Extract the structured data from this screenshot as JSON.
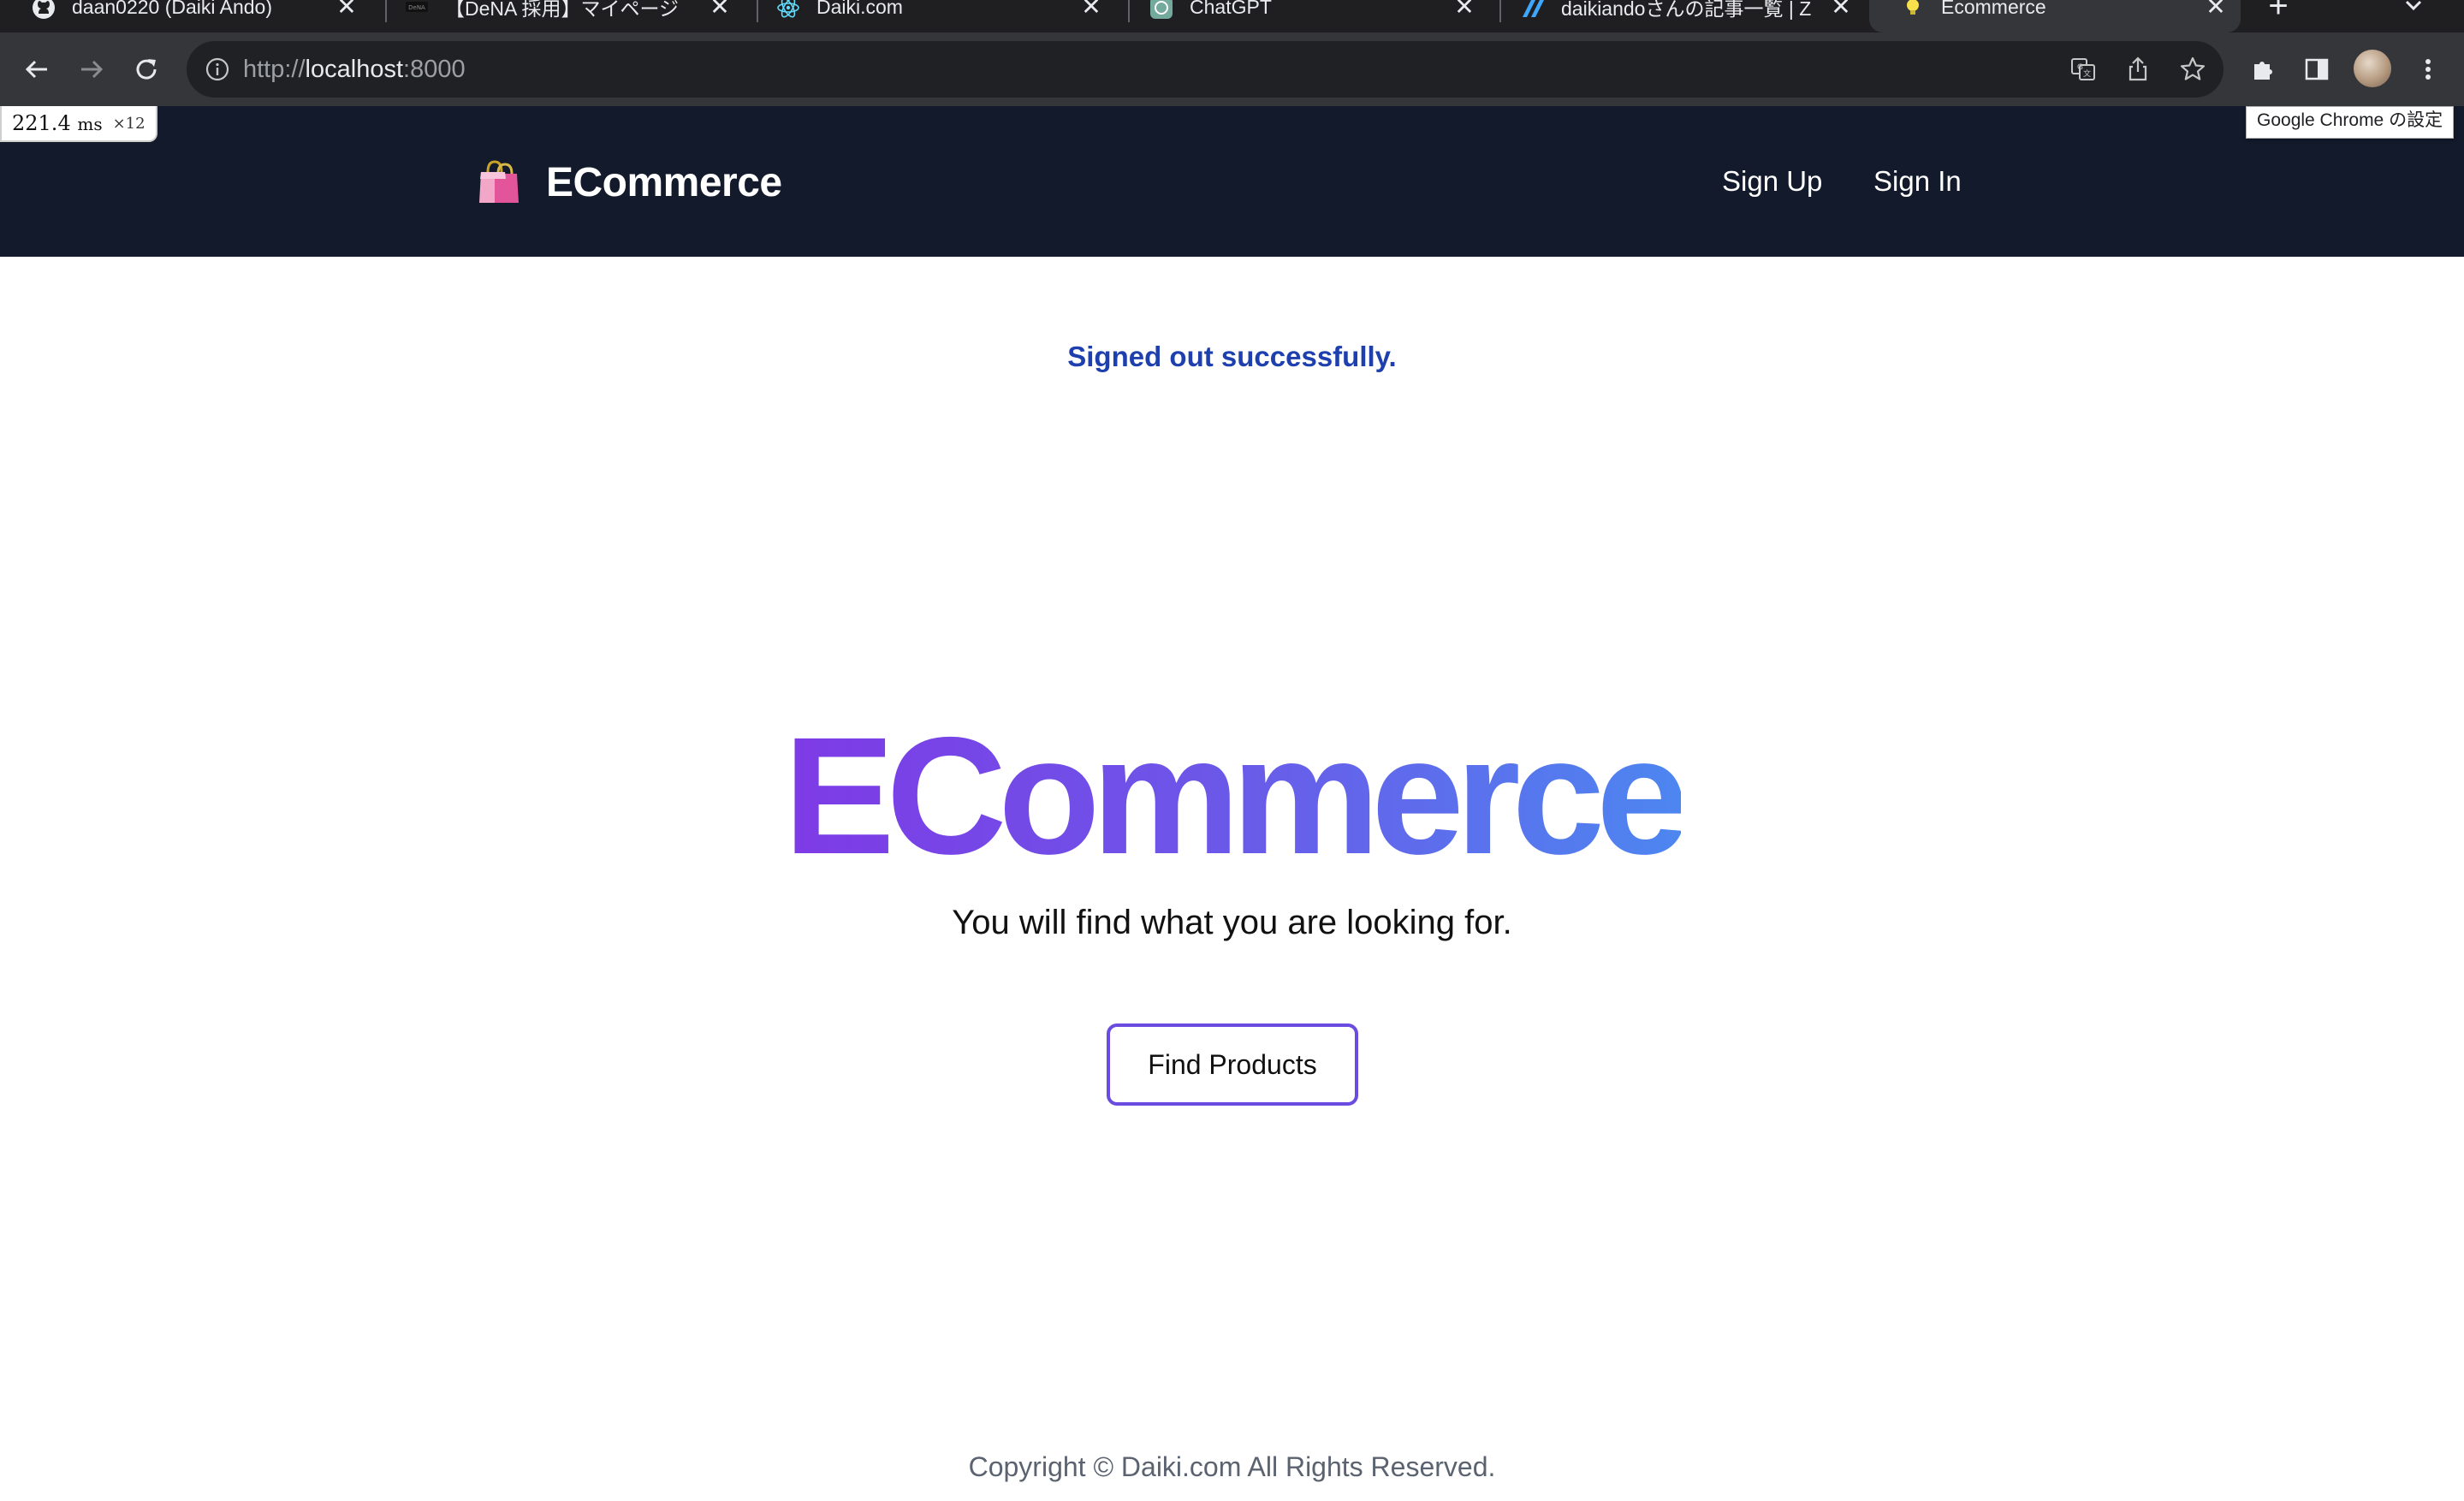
{
  "browser": {
    "tabs": [
      {
        "title": "daan0220 (Daiki Ando)",
        "favicon": "github-icon"
      },
      {
        "title": "【DeNA 採用】マイページ",
        "favicon": "dena-icon"
      },
      {
        "title": "Daiki.com",
        "favicon": "react-icon"
      },
      {
        "title": "ChatGPT",
        "favicon": "chatgpt-icon"
      },
      {
        "title": "daikiandoさんの記事一覧 | Z",
        "favicon": "zenn-icon"
      },
      {
        "title": "Ecommerce",
        "favicon": "lightbulb-icon",
        "active": true
      }
    ],
    "url_scheme": "http://",
    "url_host": "localhost",
    "url_port": ":8000",
    "tooltip": "Google Chrome の設定",
    "timing": {
      "value": "221.4",
      "unit": "ms",
      "count": "×12"
    }
  },
  "header": {
    "brand": "ECommerce",
    "logo_icon": "shopping-bags-icon",
    "nav": {
      "sign_up": "Sign Up",
      "sign_in": "Sign In"
    }
  },
  "flash": "Signed out successfully.",
  "hero": {
    "title": "ECommerce",
    "subtitle": "You will find what you are looking for.",
    "cta": "Find Products",
    "gradient": [
      "#7e3ae6",
      "#4d86f0"
    ]
  },
  "footer": {
    "copyright": "Copyright © Daiki.com All Rights Reserved."
  },
  "colors": {
    "header_bg": "#131a2b",
    "flash": "#1e40af",
    "button_border": "#6a4de0"
  }
}
